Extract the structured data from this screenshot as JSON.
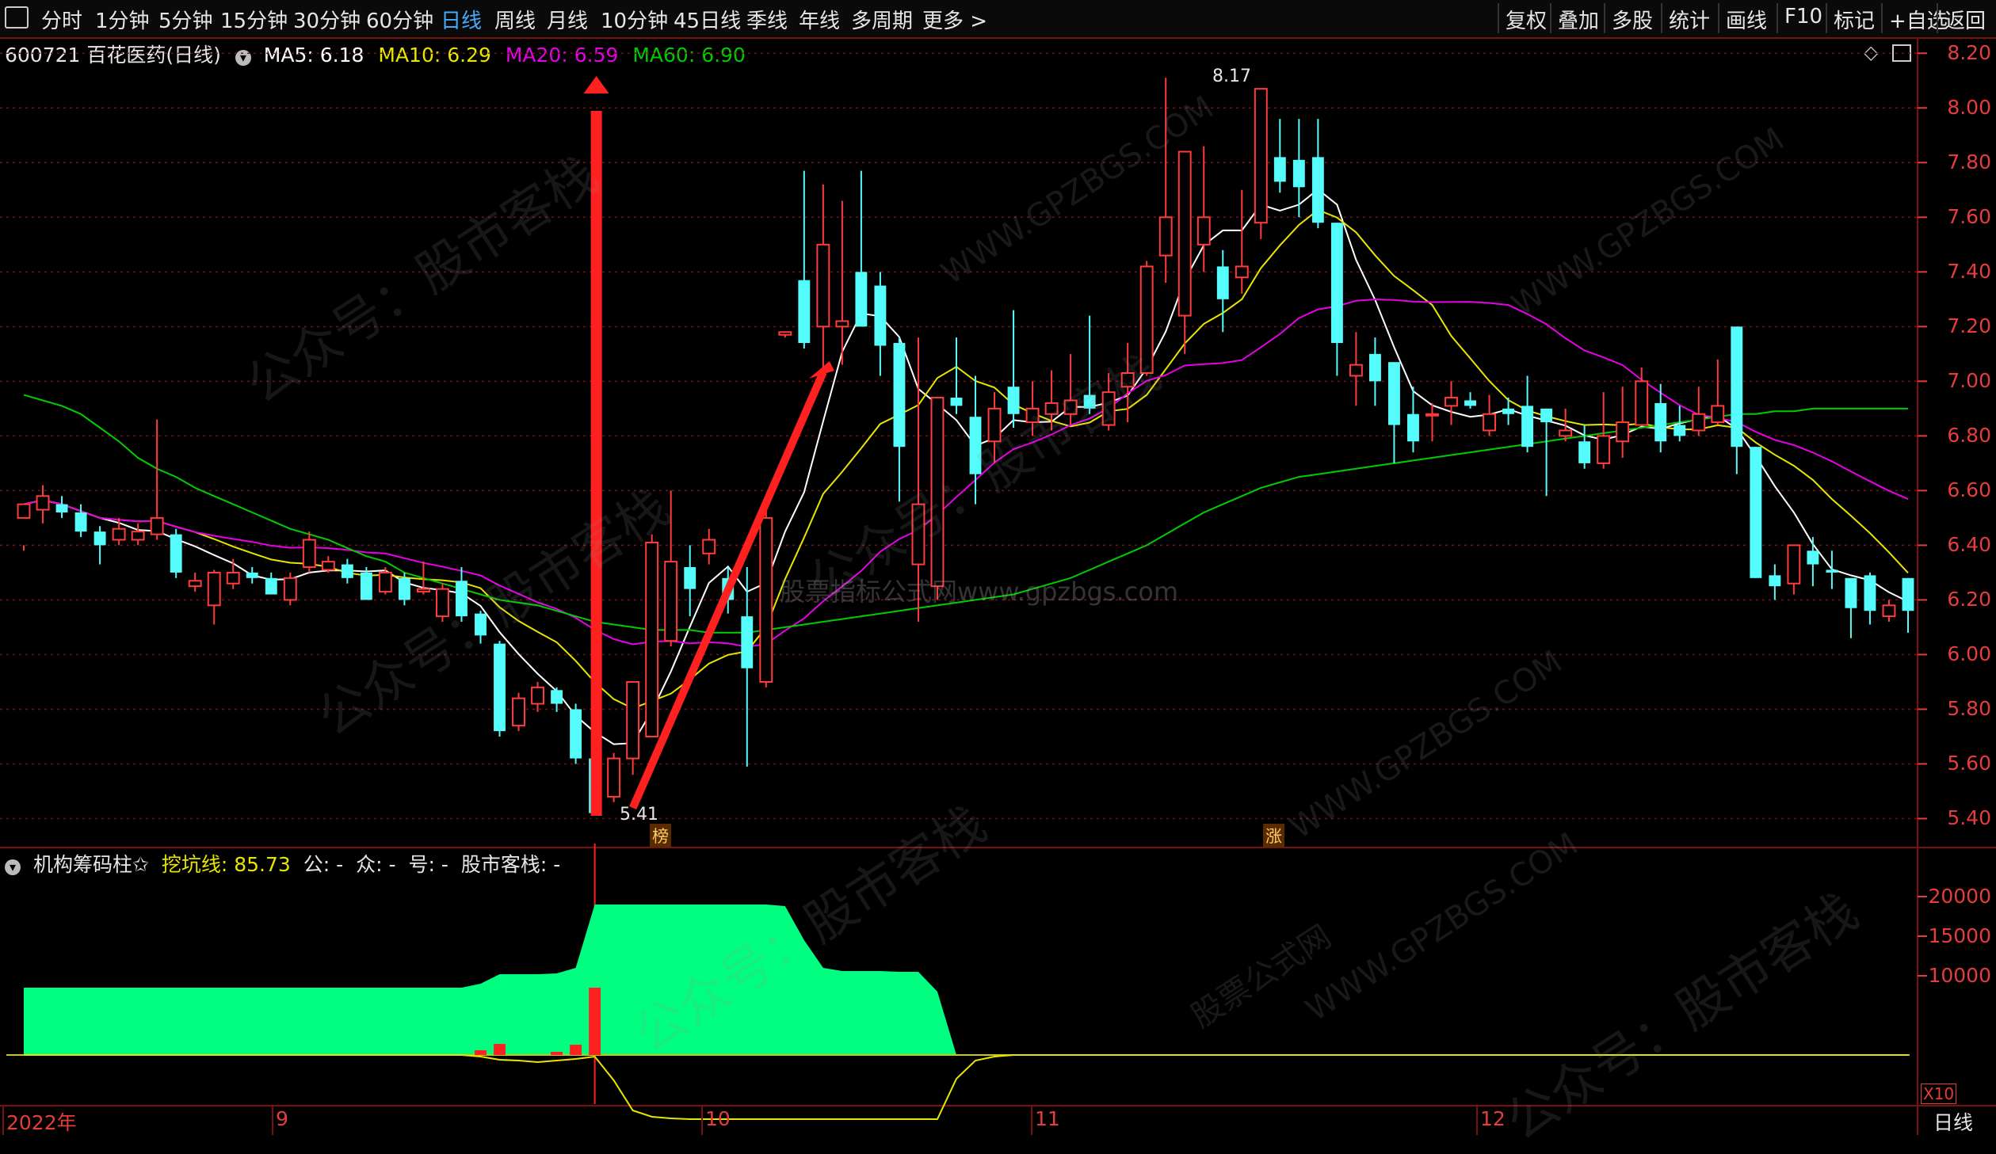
{
  "toolbar": {
    "left_items": [
      {
        "label": "分时",
        "active": false
      },
      {
        "label": "1分钟",
        "active": false
      },
      {
        "label": "5分钟",
        "active": false
      },
      {
        "label": "15分钟",
        "active": false
      },
      {
        "label": "30分钟",
        "active": false
      },
      {
        "label": "60分钟",
        "active": false
      },
      {
        "label": "日线",
        "active": true
      },
      {
        "label": "周线",
        "active": false
      },
      {
        "label": "月线",
        "active": false
      },
      {
        "label": "10分钟",
        "active": false
      },
      {
        "label": "45日线",
        "active": false
      },
      {
        "label": "季线",
        "active": false
      },
      {
        "label": "年线",
        "active": false
      },
      {
        "label": "多周期",
        "active": false
      },
      {
        "label": "更多 >",
        "active": false
      }
    ],
    "right_items": [
      "复权",
      "叠加",
      "多股",
      "统计",
      "画线",
      "F10",
      "标记",
      "+自选",
      "返回"
    ]
  },
  "price_header": {
    "stock": "600721 百花医药(日线)",
    "ma5": "MA5: 6.18",
    "ma10": "MA10: 6.29",
    "ma20": "MA20: 6.59",
    "ma60": "MA60: 6.90"
  },
  "indicator_header": {
    "name": "机构筹码柱✩",
    "wakeng": "挖坑线: 85.73",
    "gong": "公: -",
    "zhong": "众: -",
    "hao": "号: -",
    "gszz": "股市客栈: -"
  },
  "labels": {
    "low_mark": "5.41",
    "high_mark": "8.17",
    "bang": "榜",
    "zhang": "涨",
    "x10": "X10",
    "period": "日线"
  },
  "dates": [
    "2022年",
    "9",
    "10",
    "11",
    "12"
  ],
  "watermarks": {
    "gzh": "公众号：股市客栈",
    "url": "WWW.GPZBGS.COM",
    "center": "股票指标公式网www.gpzbgs.com",
    "gsgw": "股票公式网"
  },
  "colors": {
    "up": "#ff3b3b",
    "down": "#54fcfc",
    "ma5": "#ffffff",
    "ma10": "#e6e600",
    "ma20": "#e600e6",
    "ma60": "#00cc00",
    "grid": "#7a1010",
    "green_area": "#00ff80",
    "axis": "#e63c3c"
  },
  "chart_data": [
    {
      "type": "candlestick",
      "title": "600721 百花医药(日线)",
      "y_axis_ticks": [
        5.4,
        5.6,
        5.8,
        6.0,
        6.2,
        6.4,
        6.6,
        6.8,
        7.0,
        7.2,
        7.4,
        7.6,
        7.8,
        8.0,
        8.2
      ],
      "ylim": [
        5.3,
        8.25
      ],
      "grid": true,
      "annotations": [
        {
          "text": "5.41",
          "value": 5.41
        },
        {
          "text": "8.17",
          "value": 8.17
        }
      ],
      "candles": [
        [
          6.5,
          6.55,
          6.4,
          6.38
        ],
        [
          6.53,
          6.58,
          6.62,
          6.48
        ],
        [
          6.55,
          6.52,
          6.58,
          6.5
        ],
        [
          6.52,
          6.45,
          6.55,
          6.43
        ],
        [
          6.45,
          6.4,
          6.47,
          6.33
        ],
        [
          6.42,
          6.46,
          6.5,
          6.4
        ],
        [
          6.42,
          6.45,
          6.48,
          6.4
        ],
        [
          6.44,
          6.5,
          6.86,
          6.42
        ],
        [
          6.44,
          6.3,
          6.46,
          6.28
        ],
        [
          6.25,
          6.27,
          6.3,
          6.23
        ],
        [
          6.18,
          6.3,
          6.31,
          6.11
        ],
        [
          6.26,
          6.3,
          6.35,
          6.24
        ],
        [
          6.3,
          6.28,
          6.32,
          6.26
        ],
        [
          6.28,
          6.22,
          6.3,
          6.22
        ],
        [
          6.2,
          6.28,
          6.3,
          6.18
        ],
        [
          6.32,
          6.42,
          6.45,
          6.3
        ],
        [
          6.31,
          6.34,
          6.36,
          6.3
        ],
        [
          6.33,
          6.28,
          6.35,
          6.26
        ],
        [
          6.3,
          6.2,
          6.32,
          6.2
        ],
        [
          6.23,
          6.3,
          6.32,
          6.22
        ],
        [
          6.28,
          6.2,
          6.3,
          6.18
        ],
        [
          6.23,
          6.24,
          6.34,
          6.22
        ],
        [
          6.14,
          6.24,
          6.26,
          6.12
        ],
        [
          6.27,
          6.14,
          6.32,
          6.12
        ],
        [
          6.15,
          6.07,
          6.16,
          6.04
        ],
        [
          6.04,
          5.72,
          6.05,
          5.7
        ],
        [
          5.74,
          5.84,
          5.86,
          5.72
        ],
        [
          5.82,
          5.88,
          5.9,
          5.79
        ],
        [
          5.87,
          5.82,
          5.88,
          5.79
        ],
        [
          5.8,
          5.62,
          5.82,
          5.6
        ],
        [
          5.62,
          5.42,
          5.64,
          5.41
        ],
        [
          5.48,
          5.62,
          5.64,
          5.46
        ],
        [
          5.62,
          5.9,
          5.9,
          5.56
        ],
        [
          5.7,
          6.41,
          6.44,
          6.07
        ],
        [
          6.05,
          6.34,
          6.6,
          6.03
        ],
        [
          6.32,
          6.24,
          6.4,
          6.14
        ],
        [
          6.37,
          6.42,
          6.46,
          6.33
        ],
        [
          6.28,
          6.2,
          6.32,
          6.15
        ],
        [
          6.14,
          5.95,
          6.32,
          5.59
        ],
        [
          5.9,
          6.5,
          6.55,
          5.88
        ],
        [
          7.17,
          7.18,
          7.18,
          7.16
        ],
        [
          7.37,
          7.14,
          7.77,
          7.12
        ],
        [
          7.2,
          7.5,
          7.72,
          7.0
        ],
        [
          7.2,
          7.22,
          7.66,
          7.06
        ],
        [
          7.4,
          7.2,
          7.77,
          7.2
        ],
        [
          7.35,
          7.13,
          7.4,
          7.02
        ],
        [
          7.14,
          6.76,
          7.16,
          6.56
        ],
        [
          6.33,
          6.55,
          7.16,
          6.12
        ],
        [
          6.25,
          6.94,
          6.94,
          6.2
        ],
        [
          6.94,
          6.91,
          7.16,
          6.88
        ],
        [
          6.87,
          6.66,
          7.02,
          6.55
        ],
        [
          6.78,
          6.9,
          6.96,
          6.7
        ],
        [
          6.98,
          6.88,
          7.26,
          6.83
        ],
        [
          6.85,
          6.9,
          7.0,
          6.8
        ],
        [
          6.88,
          6.92,
          7.04,
          6.82
        ],
        [
          6.88,
          6.93,
          7.1,
          6.84
        ],
        [
          6.95,
          6.9,
          7.24,
          6.88
        ],
        [
          6.84,
          6.96,
          7.03,
          6.82
        ],
        [
          6.98,
          7.03,
          7.14,
          6.85
        ],
        [
          7.03,
          7.42,
          7.44,
          7.02
        ],
        [
          7.46,
          7.6,
          8.11,
          7.36
        ],
        [
          7.24,
          7.84,
          7.84,
          7.1
        ],
        [
          7.5,
          7.6,
          7.86,
          7.4
        ],
        [
          7.42,
          7.3,
          7.48,
          7.18
        ],
        [
          7.38,
          7.42,
          7.7,
          7.32
        ],
        [
          7.58,
          8.07,
          8.07,
          7.52
        ],
        [
          7.82,
          7.73,
          7.96,
          7.69
        ],
        [
          7.81,
          7.71,
          7.96,
          7.6
        ],
        [
          7.82,
          7.58,
          7.96,
          7.56
        ],
        [
          7.58,
          7.14,
          7.58,
          7.02
        ],
        [
          7.02,
          7.06,
          7.18,
          6.91
        ],
        [
          7.1,
          7.0,
          7.16,
          6.91
        ],
        [
          7.07,
          6.84,
          7.07,
          6.7
        ],
        [
          6.88,
          6.78,
          6.98,
          6.74
        ],
        [
          6.88,
          6.88,
          6.92,
          6.78
        ],
        [
          6.91,
          6.94,
          7.0,
          6.84
        ],
        [
          6.93,
          6.91,
          6.96,
          6.9
        ],
        [
          6.82,
          6.88,
          6.95,
          6.8
        ],
        [
          6.9,
          6.88,
          6.94,
          6.84
        ],
        [
          6.91,
          6.76,
          7.02,
          6.74
        ],
        [
          6.9,
          6.85,
          6.9,
          6.58
        ],
        [
          6.8,
          6.82,
          6.9,
          6.78
        ],
        [
          6.78,
          6.7,
          6.84,
          6.68
        ],
        [
          6.7,
          6.8,
          6.96,
          6.68
        ],
        [
          6.78,
          6.85,
          6.98,
          6.72
        ],
        [
          6.84,
          7.0,
          7.05,
          6.84
        ],
        [
          6.92,
          6.78,
          6.99,
          6.74
        ],
        [
          6.84,
          6.8,
          6.91,
          6.78
        ],
        [
          6.82,
          6.88,
          6.98,
          6.8
        ],
        [
          6.85,
          6.91,
          7.08,
          6.84
        ],
        [
          7.2,
          6.76,
          7.2,
          6.66
        ],
        [
          6.76,
          6.28,
          6.76,
          6.28
        ],
        [
          6.29,
          6.25,
          6.33,
          6.2
        ],
        [
          6.26,
          6.4,
          6.4,
          6.22
        ],
        [
          6.38,
          6.33,
          6.43,
          6.25
        ],
        [
          6.31,
          6.3,
          6.38,
          6.24
        ],
        [
          6.28,
          6.17,
          6.28,
          6.06
        ],
        [
          6.29,
          6.16,
          6.3,
          6.11
        ],
        [
          6.14,
          6.18,
          6.2,
          6.12
        ],
        [
          6.28,
          6.16,
          6.28,
          6.08
        ]
      ]
    },
    {
      "type": "area",
      "title": "机构筹码柱✩",
      "y_axis_ticks": [
        10000,
        15000,
        20000
      ],
      "series": [
        {
          "name": "",
          "color": "#00ff80",
          "values": [
            8500,
            8500,
            8500,
            8500,
            8500,
            8500,
            8500,
            8500,
            8500,
            8500,
            8500,
            8500,
            8500,
            8500,
            8500,
            8500,
            8500,
            8500,
            8500,
            8500,
            8500,
            8500,
            8500,
            8500,
            9000,
            10200,
            10200,
            10200,
            10300,
            11000,
            19000,
            19000,
            19000,
            19000,
            19000,
            19000,
            19000,
            19000,
            19000,
            19000,
            18800,
            14500,
            11000,
            10600,
            10600,
            10600,
            10500,
            10500,
            8000,
            0,
            0,
            0,
            0,
            0,
            0,
            0,
            0,
            0,
            0,
            0,
            0,
            0,
            0,
            0,
            0,
            0,
            0,
            0,
            0,
            0,
            0,
            0,
            0,
            0,
            0,
            0,
            0,
            0,
            0,
            0,
            0,
            0,
            0,
            0,
            0,
            0,
            0,
            0,
            0,
            0,
            0,
            0,
            0,
            0,
            0,
            0,
            0,
            0,
            0,
            0
          ]
        }
      ]
    }
  ]
}
